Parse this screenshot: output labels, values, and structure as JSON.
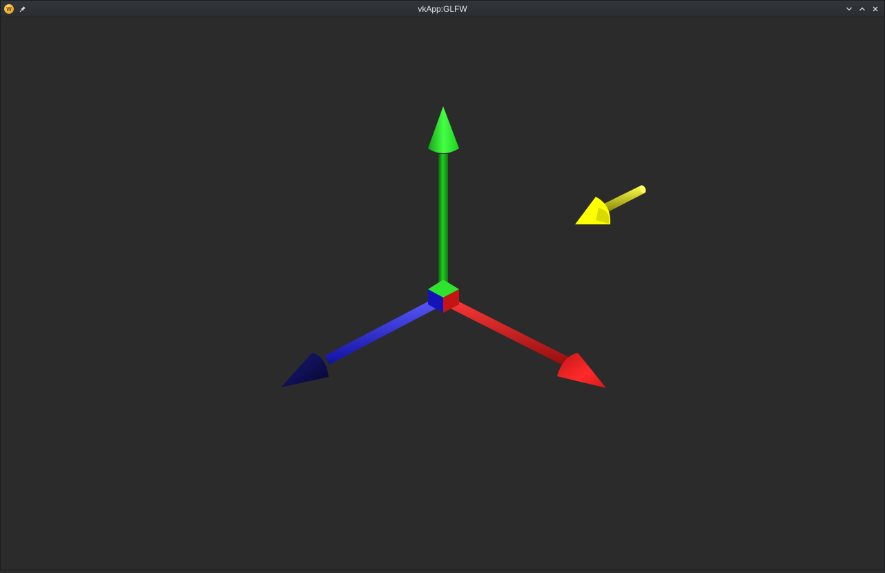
{
  "window": {
    "title": "vkApp:GLFW",
    "app_icon_glyph": "W",
    "buttons": {
      "keep_on_top": "pin-icon",
      "minimize": "chevron-down-icon",
      "maximize": "chevron-up-icon",
      "close": "close-icon"
    }
  },
  "scene": {
    "background": "#2b2b2b",
    "axes": [
      {
        "name": "x-axis",
        "color": "#ff2020"
      },
      {
        "name": "y-axis",
        "color": "#22ee22"
      },
      {
        "name": "z-axis",
        "color": "#2222ff"
      }
    ],
    "light_direction_arrow": {
      "color": "#ffff00"
    }
  }
}
